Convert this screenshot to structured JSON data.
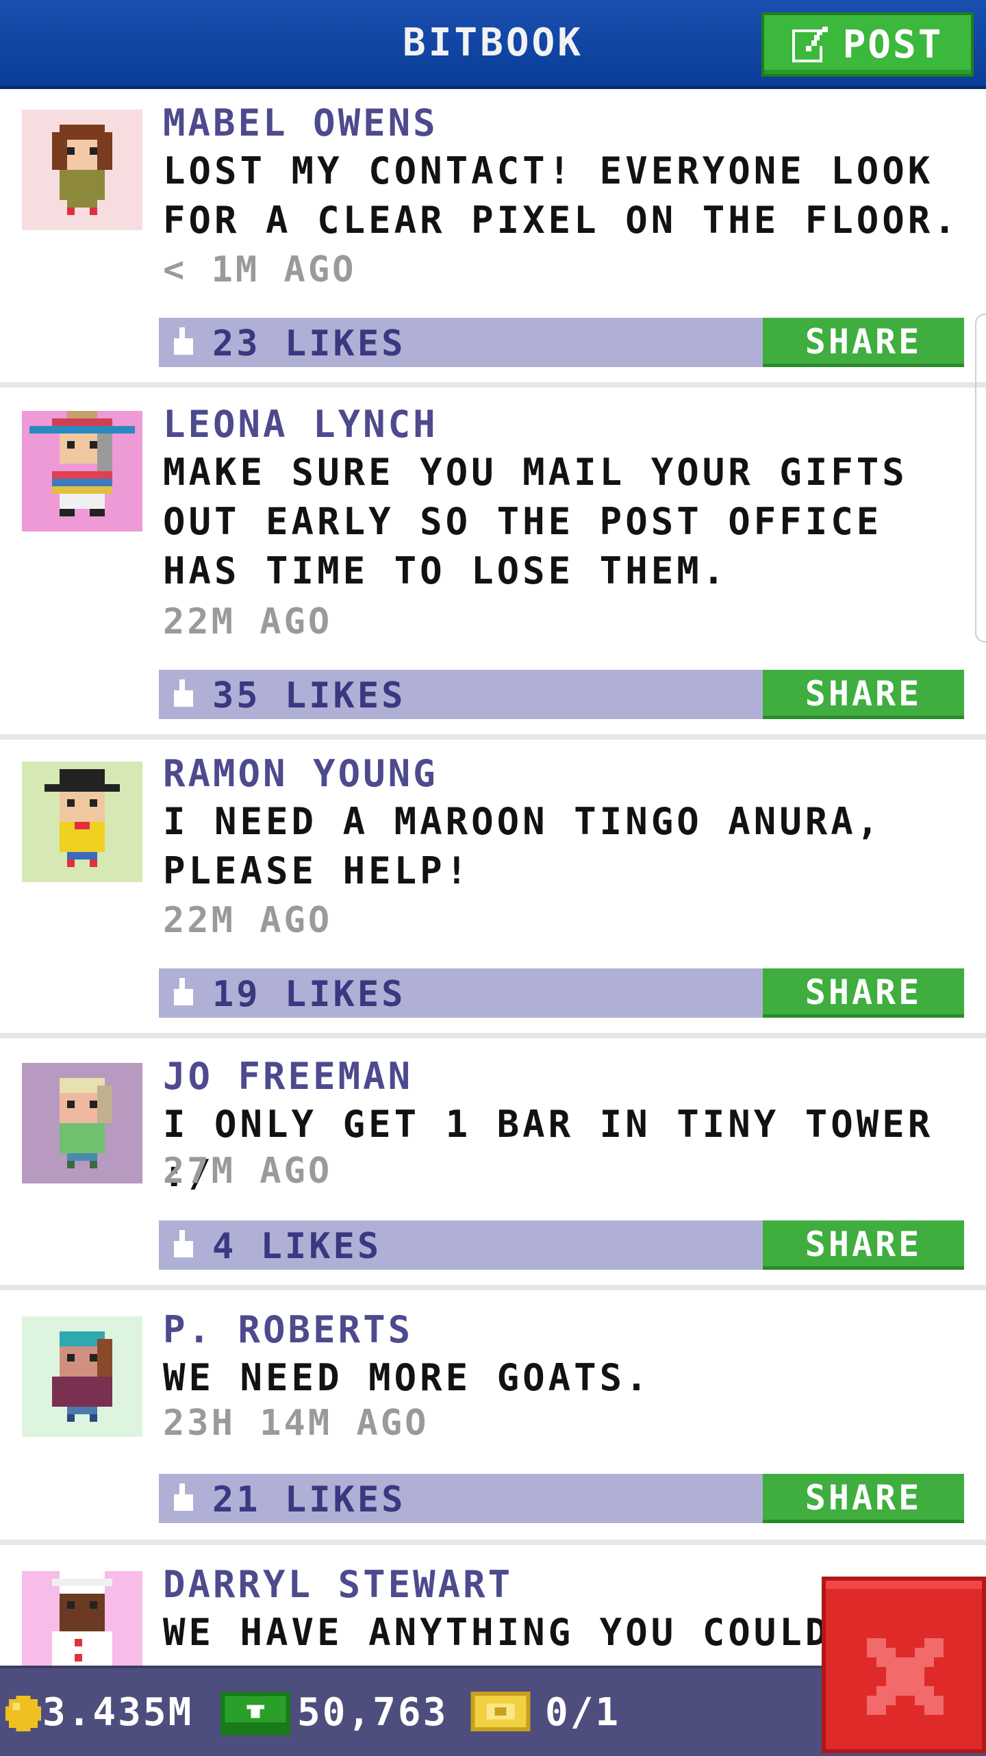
{
  "header": {
    "title": "BITBOOK",
    "post_label": "POST"
  },
  "posts": [
    {
      "author": "MABEL OWENS",
      "message": "LOST MY CONTACT! EVERYONE LOOK FOR A CLEAR PIXEL ON THE FLOOR.",
      "time": "< 1M AGO",
      "likes": "23 LIKES",
      "share_label": "SHARE",
      "avatar_bg": "#f7dde0"
    },
    {
      "author": "LEONA LYNCH",
      "message": "MAKE SURE YOU MAIL YOUR GIFTS OUT EARLY SO THE POST OFFICE HAS TIME TO LOSE THEM.",
      "time": "22M AGO",
      "likes": "35 LIKES",
      "share_label": "SHARE",
      "avatar_bg": "#ee9ad6"
    },
    {
      "author": "RAMON YOUNG",
      "message": "I NEED A MAROON TINGO ANURA, PLEASE HELP!",
      "time": "22M AGO",
      "likes": "19 LIKES",
      "share_label": "SHARE",
      "avatar_bg": "#d6e8b4"
    },
    {
      "author": "JO FREEMAN",
      "message": "I ONLY GET 1 BAR IN TINY TOWER :/",
      "time": "27M AGO",
      "likes": "4 LIKES",
      "share_label": "SHARE",
      "avatar_bg": "#b89ac0"
    },
    {
      "author": "P. ROBERTS",
      "message": "WE NEED MORE GOATS.",
      "time": "23H 14M AGO",
      "likes": "21 LIKES",
      "share_label": "SHARE",
      "avatar_bg": "#ddf5de"
    },
    {
      "author": "DARRYL STEWART",
      "message": "WE HAVE ANYTHING YOU COULD",
      "avatar_bg": "#f7bce8"
    }
  ],
  "status": {
    "coins": "3.435M",
    "bux": "50,763",
    "tickets": "0/1"
  },
  "colors": {
    "header_blue": "#0a3d98",
    "accent_green": "#3fae3f",
    "likes_bar": "#b0b0d6",
    "author_purple": "#4d4a8e",
    "status_bar": "#4e4e7e",
    "close_red": "#e02a2a"
  },
  "icons": [
    "edit-icon",
    "thumbs-up-icon",
    "coin-icon",
    "bux-icon",
    "ticket-icon",
    "close-icon"
  ]
}
